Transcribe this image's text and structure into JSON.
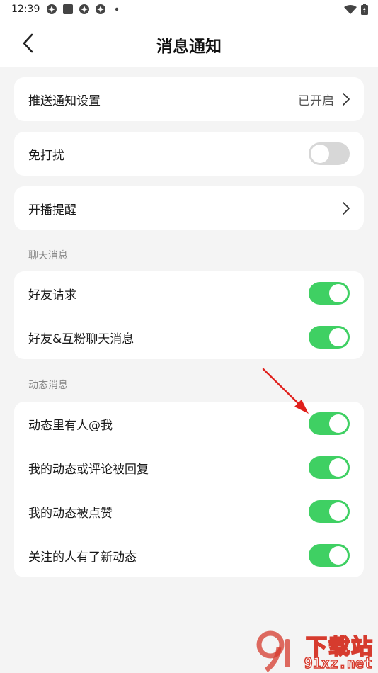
{
  "status_bar": {
    "time": "12:39"
  },
  "header": {
    "title": "消息通知"
  },
  "card_push": {
    "label": "推送通知设置",
    "value": "已开启"
  },
  "card_dnd": {
    "label": "免打扰",
    "on": false
  },
  "card_live": {
    "label": "开播提醒"
  },
  "chat_section": {
    "title": "聊天消息",
    "items": [
      {
        "label": "好友请求",
        "on": true
      },
      {
        "label": "好友&互粉聊天消息",
        "on": true
      }
    ]
  },
  "feed_section": {
    "title": "动态消息",
    "items": [
      {
        "label": "动态里有人@我",
        "on": true
      },
      {
        "label": "我的动态或评论被回复",
        "on": true
      },
      {
        "label": "我的动态被点赞",
        "on": true
      },
      {
        "label": "关注的人有了新动态",
        "on": true
      }
    ]
  },
  "watermark": {
    "brand": "下载站",
    "site": "91xz.net"
  },
  "colors": {
    "toggle_on": "#3fd063",
    "toggle_off": "#d7d7d7",
    "annotation_arrow": "#e0201c"
  }
}
